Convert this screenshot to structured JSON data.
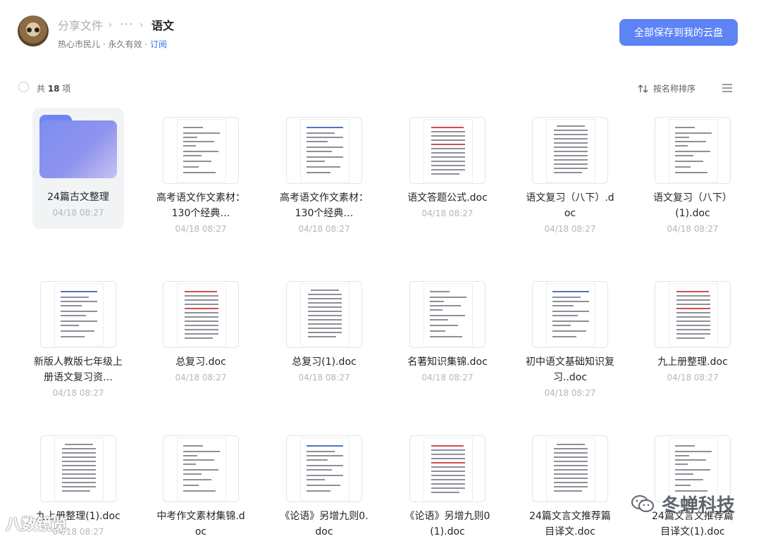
{
  "breadcrumb": {
    "root": "分享文件",
    "ellipsis": "···",
    "current": "语文"
  },
  "meta": {
    "owner": "热心市民儿",
    "separator": "·",
    "validity": "永久有效",
    "subscribe": "订阅"
  },
  "actions": {
    "save_all": "全部保存到我的云盘"
  },
  "toolbar": {
    "count_prefix": "共",
    "count": "18",
    "count_suffix": "项",
    "sort_label": "按名称排序"
  },
  "files": [
    {
      "name": "24篇古文整理",
      "time": "04/18 08:27",
      "type": "folder"
    },
    {
      "name": "高考语文作文素材：130个经典…",
      "time": "04/18 08:27",
      "type": "doc"
    },
    {
      "name": "高考语文作文素材：130个经典…",
      "time": "04/18 08:27",
      "type": "doc"
    },
    {
      "name": "语文答题公式.doc",
      "time": "04/18 08:27",
      "type": "doc"
    },
    {
      "name": "语文复习（八下）.doc",
      "time": "04/18 08:27",
      "type": "doc"
    },
    {
      "name": "语文复习（八下）(1).doc",
      "time": "04/18 08:27",
      "type": "doc"
    },
    {
      "name": "新版人教版七年级上册语文复习资…",
      "time": "04/18 08:27",
      "type": "doc"
    },
    {
      "name": "总复习.doc",
      "time": "04/18 08:27",
      "type": "doc"
    },
    {
      "name": "总复习(1).doc",
      "time": "04/18 08:27",
      "type": "doc"
    },
    {
      "name": "名著知识集锦.doc",
      "time": "04/18 08:27",
      "type": "doc"
    },
    {
      "name": "初中语文基础知识复习..doc",
      "time": "04/18 08:27",
      "type": "doc"
    },
    {
      "name": "九上册整理.doc",
      "time": "04/18 08:27",
      "type": "doc"
    },
    {
      "name": "九上册整理(1).doc",
      "time": "04/18 08:27",
      "type": "doc"
    },
    {
      "name": "中考作文素材集锦.doc",
      "time": "",
      "type": "doc"
    },
    {
      "name": "《论语》另增九则0.doc",
      "time": "",
      "type": "doc"
    },
    {
      "name": "《论语》另增九则0(1).doc",
      "time": "",
      "type": "doc"
    },
    {
      "name": "24篇文言文推荐篇目译文.doc",
      "time": "",
      "type": "doc"
    },
    {
      "name": "24篇文言文推荐篇目译文(1).doc",
      "time": "",
      "type": "doc"
    }
  ],
  "watermarks": {
    "brand": "冬蝉科技",
    "corner": "八数镜览"
  },
  "colors": {
    "accent": "#5e83f5",
    "link": "#2f6ff0",
    "folder": "#7b8ff2"
  }
}
